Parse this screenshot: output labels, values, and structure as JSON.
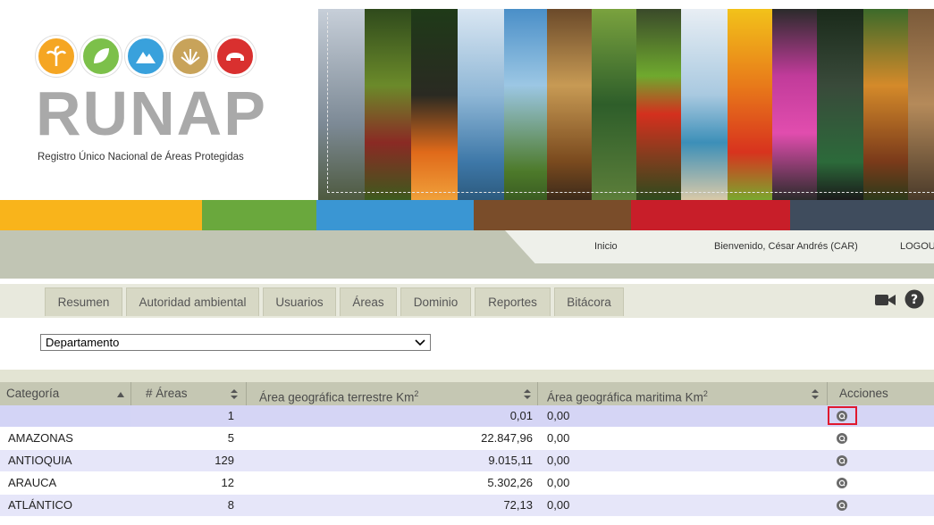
{
  "header": {
    "logo_word": "RUNAP",
    "logo_subtitle": "Registro Único Nacional de Áreas Protegidas",
    "logo_circle_colors": [
      "#f5a623",
      "#7cc04a",
      "#39a1dc",
      "#c8a35a",
      "#d9302f"
    ]
  },
  "colorbar": [
    "#f9b41b",
    "#6aa83d",
    "#3a96d3",
    "#7a4d2a",
    "#c81e29",
    "#3f4c5d"
  ],
  "topnav": {
    "home": "Inicio",
    "welcome": "Bienvenido, César Andrés (CAR)",
    "logout": "LOGOUT"
  },
  "tabs": [
    "Resumen",
    "Autoridad ambiental",
    "Usuarios",
    "Áreas",
    "Dominio",
    "Reportes",
    "Bitácora"
  ],
  "toolbar_icons": [
    "video-camera-icon",
    "help-icon"
  ],
  "filter": {
    "selected": "Departamento"
  },
  "table": {
    "headers": {
      "category": "Categoría",
      "areas": "# Áreas",
      "terrestrial": "Área geográfica terrestre Km",
      "maritime": "Área geográfica maritima Km",
      "unit_sup": "2",
      "actions": "Acciones"
    },
    "rows": [
      {
        "category": "",
        "areas": "1",
        "terrestrial": "0,01",
        "maritime": "0,00"
      },
      {
        "category": "AMAZONAS",
        "areas": "5",
        "terrestrial": "22.847,96",
        "maritime": "0,00"
      },
      {
        "category": "ANTIOQUIA",
        "areas": "129",
        "terrestrial": "9.015,11",
        "maritime": "0,00"
      },
      {
        "category": "ARAUCA",
        "areas": "12",
        "terrestrial": "5.302,26",
        "maritime": "0,00"
      },
      {
        "category": "ATLÁNTICO",
        "areas": "8",
        "terrestrial": "72,13",
        "maritime": "0,00"
      }
    ]
  }
}
